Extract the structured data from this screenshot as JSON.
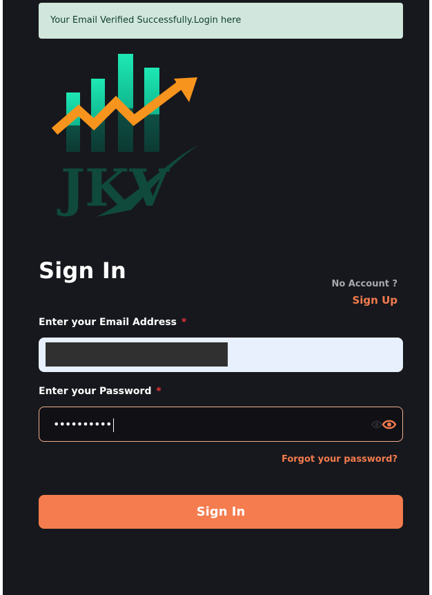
{
  "alert": {
    "message": "Your Email Verified Successfully.Login here",
    "color": "#d1e7dd"
  },
  "logo": {
    "icon": "jkv-chart-arrow-logo",
    "text": "JKV"
  },
  "form": {
    "title": "Sign In",
    "no_account_text": "No Account ?",
    "sign_up_label": "Sign Up",
    "email_label": "Enter your Email Address",
    "email_required_mark": "*",
    "email_value": "",
    "password_label": "Enter your Password",
    "password_required_mark": "*",
    "password_masked": "••••••••••",
    "password_toggle_icon": "eye-icon",
    "forgot_label": "Forgot your password?",
    "submit_label": "Sign In"
  },
  "colors": {
    "background": "#17181d",
    "accent": "#f47c4e",
    "required": "#e8333b",
    "logo_teal": "#1ee0b0",
    "logo_orange": "#f7941d",
    "logo_dark_green": "#0f4a3c"
  }
}
